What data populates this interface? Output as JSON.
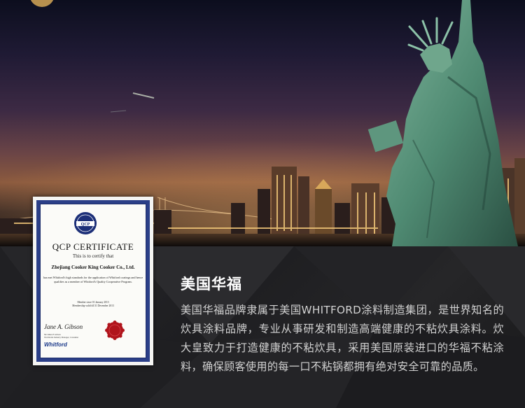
{
  "certificate": {
    "title": "QCP CERTIFICATE",
    "subtitle": "This is to certify that",
    "company": "Zhejiang Cooker King Cooker Co., Ltd.",
    "text": "has met Whitford's high standards for the application of Whitford coatings and hence qualifies as a member of Whitford's Quality Cooperative Program.",
    "date_line1": "Member since 01 January 2013",
    "date_line2": "Membership valid till 31 December 2013",
    "signature": "Jane A. Gibson",
    "signer_line1": "Mr James E Gibson",
    "signer_line2": "Worldwide Industry Manager, Consumer",
    "brand": "Whitford",
    "logo_text": "QCP"
  },
  "intro": {
    "title": "美国华福",
    "body": "美国华福品牌隶属于美国WHITFORD涂料制造集团，是世界知名的炊具涂料品牌，专业从事研发和制造高端健康的不粘炊具涂料。炊大皇致力于打造健康的不粘炊具，采用美国原装进口的华福不粘涂料，确保顾客使用的每一口不粘锅都拥有绝对安全可靠的品质。"
  },
  "colors": {
    "panel_bg": "#1e1e21",
    "title_text": "#ffffff",
    "body_text": "#d2d2d2",
    "cert_border": "#2b3f88",
    "seal_red": "#b0141c"
  }
}
